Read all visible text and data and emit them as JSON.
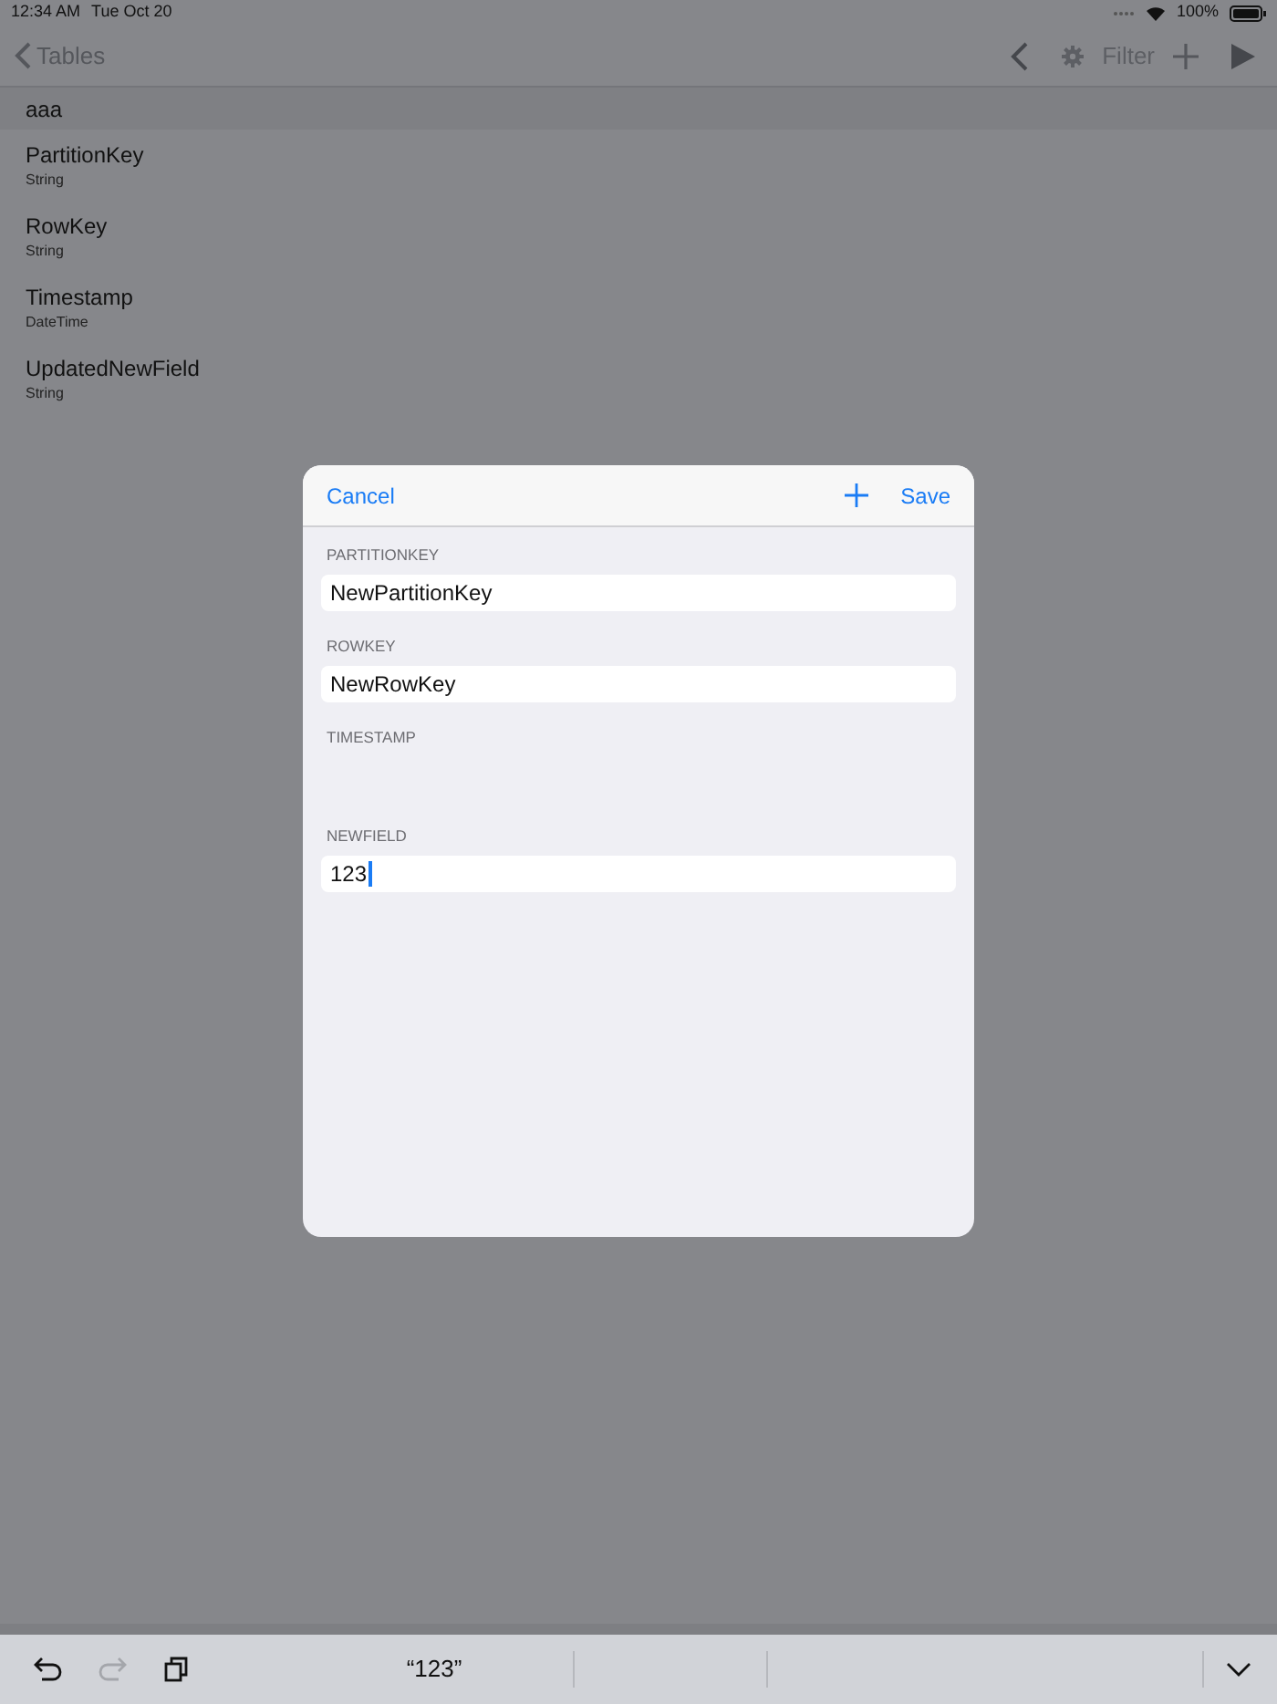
{
  "status_bar": {
    "time": "12:34 AM",
    "date": "Tue Oct 20",
    "battery": "100%"
  },
  "nav_bar": {
    "back": "Tables",
    "filter": "Filter"
  },
  "section": {
    "title": "aaa"
  },
  "columns": [
    {
      "name": "PartitionKey",
      "type": "String"
    },
    {
      "name": "RowKey",
      "type": "String"
    },
    {
      "name": "Timestamp",
      "type": "DateTime"
    },
    {
      "name": "UpdatedNewField",
      "type": "String"
    }
  ],
  "dialog": {
    "cancel": "Cancel",
    "save": "Save",
    "fields": [
      {
        "kind": "text",
        "label": "PARTITIONKEY",
        "value": "NewPartitionKey",
        "focused": false
      },
      {
        "kind": "text",
        "label": "ROWKEY",
        "value": "NewRowKey",
        "focused": false
      },
      {
        "kind": "empty",
        "label": "TIMESTAMP"
      },
      {
        "kind": "text",
        "label": "NEWFIELD",
        "value": "123",
        "focused": true
      }
    ]
  },
  "keyboard_bar": {
    "tools": [
      {
        "kind": "undo",
        "disabled": false
      },
      {
        "kind": "redo",
        "disabled": true
      },
      {
        "kind": "paste",
        "disabled": false
      }
    ],
    "suggestions": [
      "“123”"
    ]
  }
}
